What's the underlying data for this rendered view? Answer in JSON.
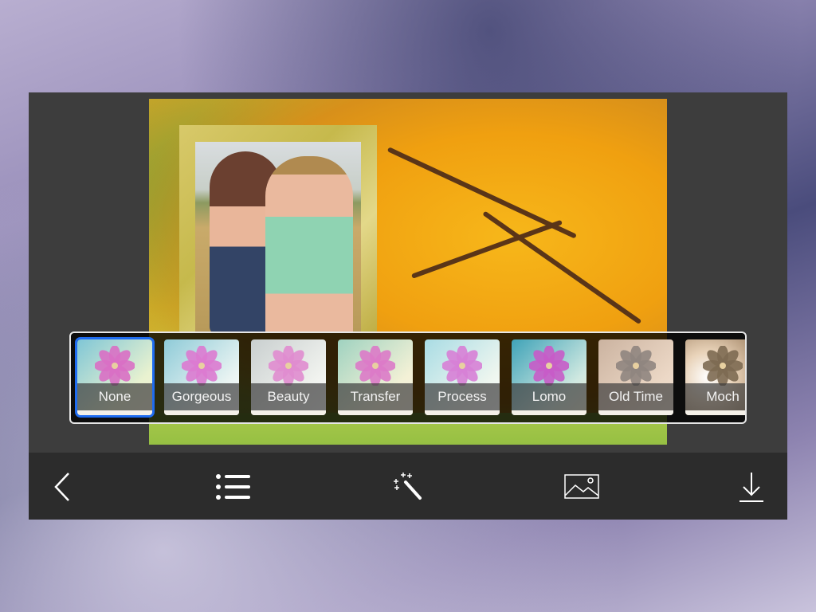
{
  "filters": [
    {
      "label": "None",
      "selected": true,
      "tint": "linear-gradient(135deg,#7fc6d6,#e9f2d0 70%,#f6f2d8)",
      "petal": "#d96fc4"
    },
    {
      "label": "Gorgeous",
      "selected": false,
      "tint": "linear-gradient(135deg,#8fcbd8,#eaf4f2 70%,#fff)",
      "petal": "#dc7ad0"
    },
    {
      "label": "Beauty",
      "selected": false,
      "tint": "linear-gradient(135deg,#c9cfcf,#f1f3ef 70%,#fff)",
      "petal": "#e08ccf"
    },
    {
      "label": "Transfer",
      "selected": false,
      "tint": "linear-gradient(135deg,#9fd2c0,#f3f1d6 70%,#fbf3df)",
      "petal": "#db7ac8"
    },
    {
      "label": "Process",
      "selected": false,
      "tint": "linear-gradient(135deg,#a9dce4,#eef6ef 70%,#fff)",
      "petal": "#d77fd6"
    },
    {
      "label": "Lomo",
      "selected": false,
      "tint": "linear-gradient(135deg,#3fa3b8,#cfe8e0 70%,#f3f0d6)",
      "petal": "#c85bc8"
    },
    {
      "label": "Old Time",
      "selected": false,
      "tint": "linear-gradient(135deg,#cbb3a0,#ecd8c6 70%,#f2e4d4)",
      "petal": "#8f8580"
    },
    {
      "label": "Moch",
      "selected": false,
      "tint": "radial-gradient(circle at 30% 50%,#fff 0%,#e8d2b8 40%,#9a7c5c 100%)",
      "petal": "#7d6a52"
    }
  ],
  "toolbar": {
    "back": "back-icon",
    "list": "list-icon",
    "effects": "magic-wand-icon",
    "background": "image-icon",
    "save": "download-icon"
  },
  "colors": {
    "selection": "#1f6cf0",
    "toolbar": "#2c2c2c",
    "panel": "#3d3d3d"
  }
}
